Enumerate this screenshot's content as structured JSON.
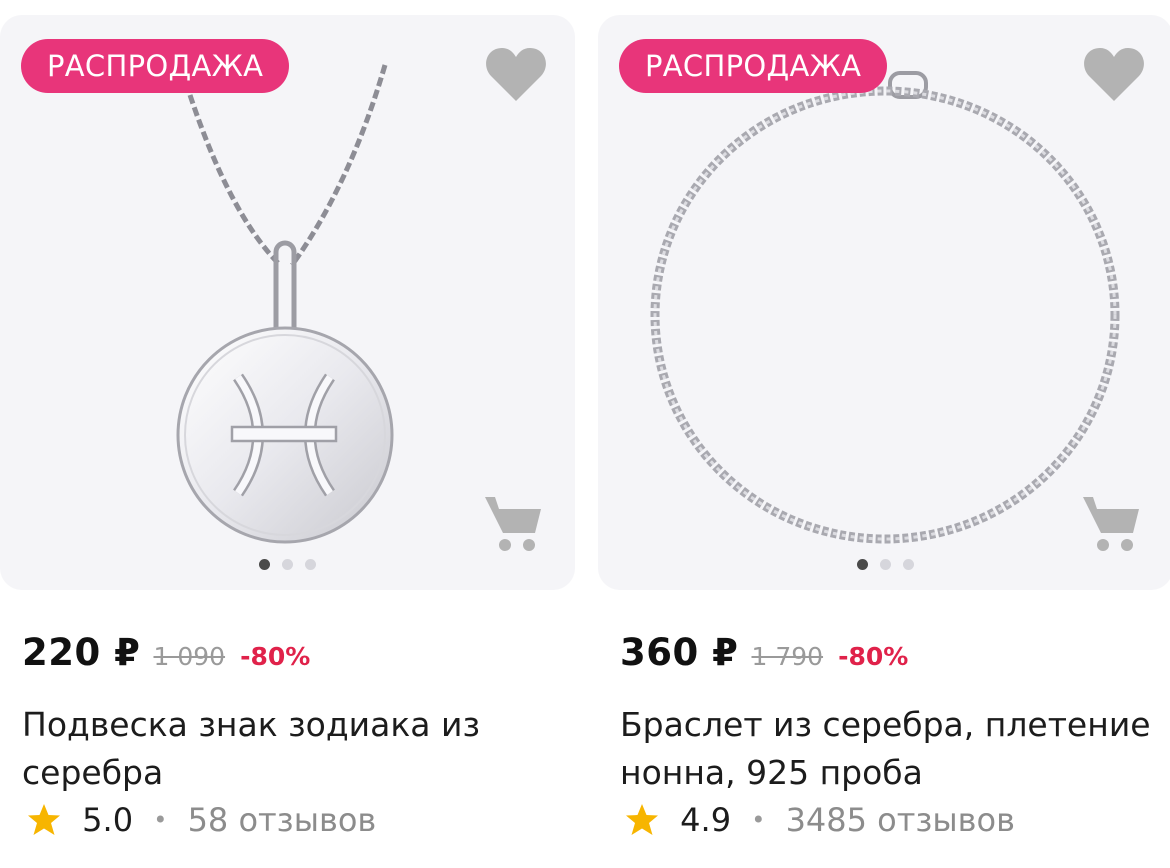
{
  "products": [
    {
      "badge": "РАСПРОДАЖА",
      "price": "220 ₽",
      "old_price": "1 090",
      "discount": "-80%",
      "title": "Подвеска знак зодиака из серебра",
      "rating": "5.0",
      "separator": "•",
      "reviews": "58 отзывов",
      "image_pages": 3,
      "active_page": 1,
      "icons": [
        "heart-icon",
        "cart-icon",
        "star-icon"
      ]
    },
    {
      "badge": "РАСПРОДАЖА",
      "price": "360 ₽",
      "old_price": "1 790",
      "discount": "-80%",
      "title": "Браслет из серебра, плетение нонна, 925 проба",
      "rating": "4.9",
      "separator": "•",
      "reviews": "3485 отзывов",
      "image_pages": 3,
      "active_page": 1,
      "icons": [
        "heart-icon",
        "cart-icon",
        "star-icon"
      ]
    }
  ],
  "colors": {
    "badge_bg": "#e8357a",
    "discount": "#e0224a",
    "card_bg": "#f5f5f8",
    "icon_gray": "#b3b3b3",
    "star": "#f7b500"
  }
}
